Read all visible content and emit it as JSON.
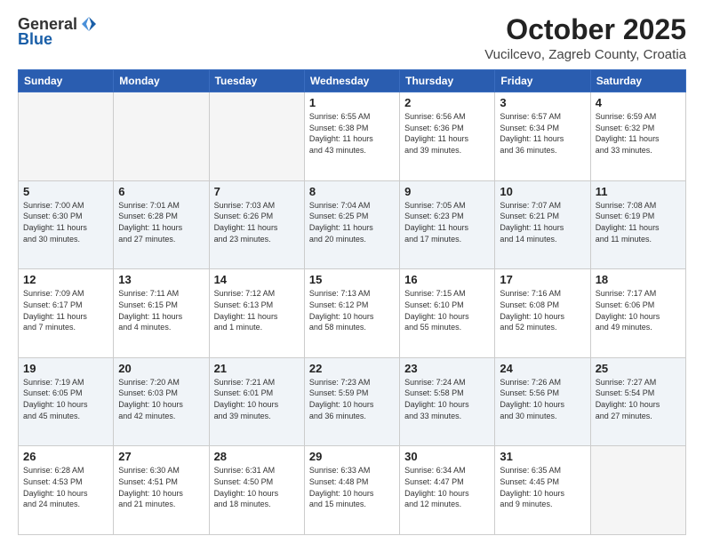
{
  "header": {
    "logo_general": "General",
    "logo_blue": "Blue",
    "month": "October 2025",
    "location": "Vucilcevo, Zagreb County, Croatia"
  },
  "weekdays": [
    "Sunday",
    "Monday",
    "Tuesday",
    "Wednesday",
    "Thursday",
    "Friday",
    "Saturday"
  ],
  "weeks": [
    [
      {
        "day": "",
        "info": ""
      },
      {
        "day": "",
        "info": ""
      },
      {
        "day": "",
        "info": ""
      },
      {
        "day": "1",
        "info": "Sunrise: 6:55 AM\nSunset: 6:38 PM\nDaylight: 11 hours\nand 43 minutes."
      },
      {
        "day": "2",
        "info": "Sunrise: 6:56 AM\nSunset: 6:36 PM\nDaylight: 11 hours\nand 39 minutes."
      },
      {
        "day": "3",
        "info": "Sunrise: 6:57 AM\nSunset: 6:34 PM\nDaylight: 11 hours\nand 36 minutes."
      },
      {
        "day": "4",
        "info": "Sunrise: 6:59 AM\nSunset: 6:32 PM\nDaylight: 11 hours\nand 33 minutes."
      }
    ],
    [
      {
        "day": "5",
        "info": "Sunrise: 7:00 AM\nSunset: 6:30 PM\nDaylight: 11 hours\nand 30 minutes."
      },
      {
        "day": "6",
        "info": "Sunrise: 7:01 AM\nSunset: 6:28 PM\nDaylight: 11 hours\nand 27 minutes."
      },
      {
        "day": "7",
        "info": "Sunrise: 7:03 AM\nSunset: 6:26 PM\nDaylight: 11 hours\nand 23 minutes."
      },
      {
        "day": "8",
        "info": "Sunrise: 7:04 AM\nSunset: 6:25 PM\nDaylight: 11 hours\nand 20 minutes."
      },
      {
        "day": "9",
        "info": "Sunrise: 7:05 AM\nSunset: 6:23 PM\nDaylight: 11 hours\nand 17 minutes."
      },
      {
        "day": "10",
        "info": "Sunrise: 7:07 AM\nSunset: 6:21 PM\nDaylight: 11 hours\nand 14 minutes."
      },
      {
        "day": "11",
        "info": "Sunrise: 7:08 AM\nSunset: 6:19 PM\nDaylight: 11 hours\nand 11 minutes."
      }
    ],
    [
      {
        "day": "12",
        "info": "Sunrise: 7:09 AM\nSunset: 6:17 PM\nDaylight: 11 hours\nand 7 minutes."
      },
      {
        "day": "13",
        "info": "Sunrise: 7:11 AM\nSunset: 6:15 PM\nDaylight: 11 hours\nand 4 minutes."
      },
      {
        "day": "14",
        "info": "Sunrise: 7:12 AM\nSunset: 6:13 PM\nDaylight: 11 hours\nand 1 minute."
      },
      {
        "day": "15",
        "info": "Sunrise: 7:13 AM\nSunset: 6:12 PM\nDaylight: 10 hours\nand 58 minutes."
      },
      {
        "day": "16",
        "info": "Sunrise: 7:15 AM\nSunset: 6:10 PM\nDaylight: 10 hours\nand 55 minutes."
      },
      {
        "day": "17",
        "info": "Sunrise: 7:16 AM\nSunset: 6:08 PM\nDaylight: 10 hours\nand 52 minutes."
      },
      {
        "day": "18",
        "info": "Sunrise: 7:17 AM\nSunset: 6:06 PM\nDaylight: 10 hours\nand 49 minutes."
      }
    ],
    [
      {
        "day": "19",
        "info": "Sunrise: 7:19 AM\nSunset: 6:05 PM\nDaylight: 10 hours\nand 45 minutes."
      },
      {
        "day": "20",
        "info": "Sunrise: 7:20 AM\nSunset: 6:03 PM\nDaylight: 10 hours\nand 42 minutes."
      },
      {
        "day": "21",
        "info": "Sunrise: 7:21 AM\nSunset: 6:01 PM\nDaylight: 10 hours\nand 39 minutes."
      },
      {
        "day": "22",
        "info": "Sunrise: 7:23 AM\nSunset: 5:59 PM\nDaylight: 10 hours\nand 36 minutes."
      },
      {
        "day": "23",
        "info": "Sunrise: 7:24 AM\nSunset: 5:58 PM\nDaylight: 10 hours\nand 33 minutes."
      },
      {
        "day": "24",
        "info": "Sunrise: 7:26 AM\nSunset: 5:56 PM\nDaylight: 10 hours\nand 30 minutes."
      },
      {
        "day": "25",
        "info": "Sunrise: 7:27 AM\nSunset: 5:54 PM\nDaylight: 10 hours\nand 27 minutes."
      }
    ],
    [
      {
        "day": "26",
        "info": "Sunrise: 6:28 AM\nSunset: 4:53 PM\nDaylight: 10 hours\nand 24 minutes."
      },
      {
        "day": "27",
        "info": "Sunrise: 6:30 AM\nSunset: 4:51 PM\nDaylight: 10 hours\nand 21 minutes."
      },
      {
        "day": "28",
        "info": "Sunrise: 6:31 AM\nSunset: 4:50 PM\nDaylight: 10 hours\nand 18 minutes."
      },
      {
        "day": "29",
        "info": "Sunrise: 6:33 AM\nSunset: 4:48 PM\nDaylight: 10 hours\nand 15 minutes."
      },
      {
        "day": "30",
        "info": "Sunrise: 6:34 AM\nSunset: 4:47 PM\nDaylight: 10 hours\nand 12 minutes."
      },
      {
        "day": "31",
        "info": "Sunrise: 6:35 AM\nSunset: 4:45 PM\nDaylight: 10 hours\nand 9 minutes."
      },
      {
        "day": "",
        "info": ""
      }
    ]
  ]
}
